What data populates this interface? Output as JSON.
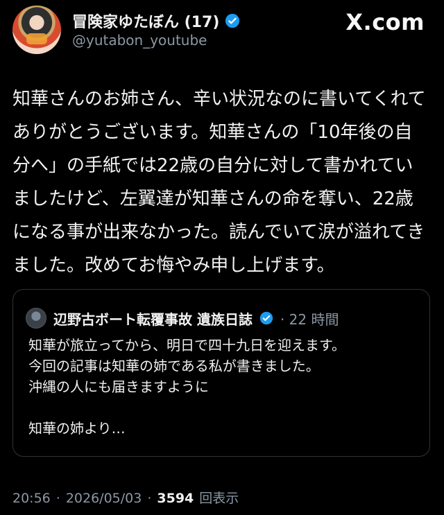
{
  "author": {
    "display_name": "冒険家ゆたぼん (17)",
    "handle": "@yutabon_youtube",
    "verified_icon": "verified-badge",
    "badge_color": "#1d9bf0"
  },
  "brand": {
    "text": "X.com"
  },
  "post": {
    "lines": [
      "知華さんのお姉さん、辛い状況なのに書いてくれて",
      "ありがとうございます。知華さんの「10年後の自",
      "分へ」の手紙では22歳の自分に対して書かれてい",
      "ましたけど、左翼達が知華さんの命を奪い、22歳",
      "になる事が出来なかった。読んでいて涙が溢れてき",
      "ました。改めてお悔やみ申し上げます。"
    ]
  },
  "quote": {
    "author_name": "辺野古ボート転覆事故 遺族日誌",
    "time_meta": "· 22 時間",
    "lines": [
      "知華が旅立ってから、明日で四十九日を迎えます。",
      "今回の記事は知華の姉である私が書きました。",
      "沖縄の人にも届きますように",
      "",
      "知華の姉より…"
    ]
  },
  "footer": {
    "time": "20:56",
    "sep1": "·",
    "date": "2026/05/03",
    "sep2": "·",
    "views_count": "3594",
    "views_label": "回表示"
  }
}
